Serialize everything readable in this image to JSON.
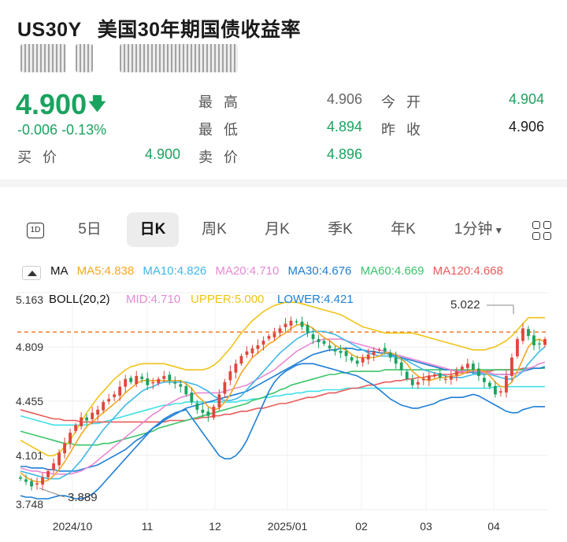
{
  "header": {
    "symbol": "US30Y",
    "name": "美国30年期国债收益率"
  },
  "quote": {
    "price": "4.900",
    "change": "-0.006",
    "change_pct": "-0.13%",
    "high_label": "最高",
    "high": "4.906",
    "open_label": "今开",
    "open": "4.904",
    "low_label": "最低",
    "low": "4.894",
    "prev_close_label": "昨收",
    "prev_close": "4.906",
    "bid_label": "买价",
    "bid": "4.900",
    "ask_label": "卖价",
    "ask": "4.896"
  },
  "tabs": [
    "5日",
    "日K",
    "周K",
    "月K",
    "季K",
    "年K",
    "1分钟"
  ],
  "active_tab": "日K",
  "indicators": {
    "ma_label": "MA",
    "ma5": "MA5:4.838",
    "ma10": "MA10:4.826",
    "ma20": "MA20:4.710",
    "ma30": "MA30:4.676",
    "ma60": "MA60:4.669",
    "ma120": "MA120:4.668",
    "boll": "BOLL(20,2)",
    "mid": "MID:4.710",
    "upper": "UPPER:5.000",
    "lower": "LOWER:4.421"
  },
  "colors": {
    "up": "#e0463c",
    "down": "#1aa35f",
    "ma5": "#f5a623",
    "ma10": "#3fb8e8",
    "ma20": "#e889d4",
    "ma30": "#1e7fd6",
    "ma60": "#3cc46a",
    "ma120": "#e85b5b",
    "upper": "#f0c419",
    "lower": "#6baef0"
  },
  "chart_data": {
    "type": "candlestick",
    "y_ticks": [
      "5.163",
      "4.809",
      "4.455",
      "4.101",
      "3.748"
    ],
    "ylim": [
      3.748,
      5.163
    ],
    "x_ticks": [
      "2024/10",
      "11",
      "12",
      "2025/01",
      "02",
      "03",
      "04"
    ],
    "annotations": {
      "max": "5.022",
      "min": "3.889"
    },
    "reference_line": 4.906,
    "closes": [
      3.95,
      3.93,
      3.9,
      3.92,
      3.96,
      4.0,
      4.05,
      4.12,
      4.18,
      4.25,
      4.3,
      4.35,
      4.33,
      4.38,
      4.4,
      4.45,
      4.47,
      4.5,
      4.55,
      4.6,
      4.58,
      4.62,
      4.6,
      4.56,
      4.58,
      4.6,
      4.62,
      4.59,
      4.57,
      4.55,
      4.5,
      4.45,
      4.4,
      4.38,
      4.36,
      4.42,
      4.5,
      4.58,
      4.65,
      4.7,
      4.75,
      4.78,
      4.8,
      4.82,
      4.85,
      4.88,
      4.9,
      4.93,
      4.96,
      4.98,
      4.97,
      4.94,
      4.9,
      4.86,
      4.84,
      4.83,
      4.8,
      4.78,
      4.77,
      4.75,
      4.72,
      4.7,
      4.74,
      4.76,
      4.78,
      4.79,
      4.78,
      4.74,
      4.7,
      4.66,
      4.6,
      4.56,
      4.58,
      4.6,
      4.62,
      4.63,
      4.61,
      4.6,
      4.62,
      4.65,
      4.68,
      4.7,
      4.66,
      4.62,
      4.58,
      4.55,
      4.5,
      4.52,
      4.62,
      4.74,
      4.86,
      4.93,
      4.88,
      4.82,
      4.83,
      4.86
    ],
    "ma5": [
      3.99,
      3.96,
      3.94,
      3.93,
      3.93,
      3.94,
      3.97,
      4.01,
      4.06,
      4.12,
      4.18,
      4.24,
      4.29,
      4.32,
      4.35,
      4.38,
      4.41,
      4.44,
      4.47,
      4.51,
      4.54,
      4.57,
      4.59,
      4.59,
      4.59,
      4.59,
      4.59,
      4.59,
      4.59,
      4.59,
      4.57,
      4.54,
      4.49,
      4.46,
      4.42,
      4.4,
      4.41,
      4.45,
      4.5,
      4.57,
      4.64,
      4.69,
      4.74,
      4.77,
      4.8,
      4.83,
      4.85,
      4.88,
      4.9,
      4.93,
      4.95,
      4.96,
      4.95,
      4.93,
      4.9,
      4.87,
      4.85,
      4.82,
      4.8,
      4.79,
      4.76,
      4.74,
      4.74,
      4.74,
      4.74,
      4.75,
      4.77,
      4.77,
      4.76,
      4.73,
      4.7,
      4.65,
      4.62,
      4.6,
      4.59,
      4.6,
      4.61,
      4.61,
      4.62,
      4.62,
      4.63,
      4.65,
      4.66,
      4.66,
      4.65,
      4.62,
      4.58,
      4.55,
      4.55,
      4.58,
      4.65,
      4.73,
      4.81,
      4.85,
      4.86,
      4.84
    ],
    "ma10": [
      4.0,
      3.99,
      3.98,
      3.97,
      3.96,
      3.95,
      3.95,
      3.95,
      3.97,
      3.99,
      4.03,
      4.07,
      4.12,
      4.17,
      4.22,
      4.27,
      4.31,
      4.35,
      4.39,
      4.43,
      4.46,
      4.49,
      4.52,
      4.54,
      4.55,
      4.57,
      4.58,
      4.58,
      4.58,
      4.58,
      4.58,
      4.57,
      4.56,
      4.54,
      4.52,
      4.49,
      4.47,
      4.46,
      4.46,
      4.47,
      4.49,
      4.53,
      4.57,
      4.61,
      4.65,
      4.69,
      4.73,
      4.77,
      4.8,
      4.83,
      4.86,
      4.88,
      4.9,
      4.91,
      4.91,
      4.91,
      4.9,
      4.89,
      4.87,
      4.85,
      4.83,
      4.81,
      4.79,
      4.77,
      4.76,
      4.75,
      4.75,
      4.75,
      4.74,
      4.73,
      4.72,
      4.7,
      4.68,
      4.66,
      4.65,
      4.64,
      4.63,
      4.62,
      4.61,
      4.61,
      4.61,
      4.62,
      4.63,
      4.63,
      4.63,
      4.63,
      4.62,
      4.61,
      4.6,
      4.6,
      4.62,
      4.65,
      4.7,
      4.74,
      4.78,
      4.81
    ],
    "ma20": [
      4.02,
      4.01,
      4.0,
      4.0,
      3.99,
      3.99,
      3.98,
      3.98,
      3.98,
      3.98,
      3.99,
      4.0,
      4.02,
      4.04,
      4.07,
      4.1,
      4.13,
      4.16,
      4.19,
      4.22,
      4.25,
      4.28,
      4.31,
      4.34,
      4.37,
      4.39,
      4.42,
      4.44,
      4.46,
      4.48,
      4.49,
      4.5,
      4.51,
      4.51,
      4.51,
      4.51,
      4.51,
      4.52,
      4.53,
      4.54,
      4.55,
      4.56,
      4.58,
      4.6,
      4.62,
      4.64,
      4.66,
      4.69,
      4.72,
      4.75,
      4.78,
      4.8,
      4.82,
      4.84,
      4.85,
      4.86,
      4.86,
      4.86,
      4.86,
      4.85,
      4.84,
      4.83,
      4.82,
      4.81,
      4.8,
      4.79,
      4.78,
      4.77,
      4.76,
      4.75,
      4.74,
      4.73,
      4.72,
      4.71,
      4.7,
      4.69,
      4.68,
      4.67,
      4.66,
      4.65,
      4.65,
      4.65,
      4.65,
      4.65,
      4.64,
      4.64,
      4.63,
      4.63,
      4.63,
      4.63,
      4.64,
      4.65,
      4.67,
      4.68,
      4.7,
      4.71
    ],
    "ma30": [
      4.03,
      4.03,
      4.02,
      4.02,
      4.02,
      4.01,
      4.01,
      4.0,
      4.0,
      4.0,
      4.0,
      4.01,
      4.02,
      4.03,
      4.04,
      4.06,
      4.08,
      4.1,
      4.12,
      4.14,
      4.17,
      4.2,
      4.22,
      4.25,
      4.28,
      4.3,
      4.33,
      4.35,
      4.37,
      4.39,
      4.41,
      4.42,
      4.43,
      4.44,
      4.45,
      4.46,
      4.47,
      4.48,
      4.49,
      4.5,
      4.51,
      4.52,
      4.54,
      4.56,
      4.58,
      4.6,
      4.62,
      4.64,
      4.66,
      4.68,
      4.7,
      4.72,
      4.74,
      4.76,
      4.77,
      4.78,
      4.79,
      4.79,
      4.8,
      4.8,
      4.8,
      4.79,
      4.79,
      4.78,
      4.78,
      4.77,
      4.77,
      4.76,
      4.75,
      4.74,
      4.73,
      4.72,
      4.71,
      4.7,
      4.69,
      4.68,
      4.67,
      4.66,
      4.66,
      4.65,
      4.65,
      4.65,
      4.64,
      4.64,
      4.64,
      4.64,
      4.63,
      4.63,
      4.63,
      4.63,
      4.64,
      4.65,
      4.66,
      4.67,
      4.67,
      4.68
    ],
    "ma60": [
      4.26,
      4.25,
      4.24,
      4.23,
      4.22,
      4.21,
      4.2,
      4.19,
      4.18,
      4.18,
      4.17,
      4.17,
      4.17,
      4.17,
      4.17,
      4.18,
      4.18,
      4.19,
      4.2,
      4.21,
      4.22,
      4.23,
      4.24,
      4.25,
      4.26,
      4.28,
      4.29,
      4.3,
      4.31,
      4.32,
      4.33,
      4.34,
      4.35,
      4.36,
      4.37,
      4.38,
      4.39,
      4.4,
      4.41,
      4.42,
      4.43,
      4.44,
      4.46,
      4.47,
      4.48,
      4.5,
      4.51,
      4.53,
      4.54,
      4.56,
      4.57,
      4.58,
      4.59,
      4.6,
      4.61,
      4.62,
      4.63,
      4.63,
      4.64,
      4.64,
      4.65,
      4.65,
      4.65,
      4.65,
      4.65,
      4.65,
      4.66,
      4.66,
      4.66,
      4.66,
      4.66,
      4.66,
      4.66,
      4.66,
      4.66,
      4.66,
      4.66,
      4.66,
      4.66,
      4.66,
      4.66,
      4.66,
      4.66,
      4.66,
      4.66,
      4.66,
      4.66,
      4.66,
      4.66,
      4.66,
      4.66,
      4.66,
      4.67,
      4.67,
      4.67,
      4.67
    ],
    "ma120": [
      4.4,
      4.39,
      4.38,
      4.37,
      4.36,
      4.35,
      4.34,
      4.34,
      4.33,
      4.33,
      4.33,
      4.32,
      4.32,
      4.32,
      4.32,
      4.32,
      4.32,
      4.32,
      4.32,
      4.32,
      4.32,
      4.32,
      4.32,
      4.32,
      4.32,
      4.32,
      4.32,
      4.33,
      4.33,
      4.33,
      4.33,
      4.34,
      4.34,
      4.35,
      4.35,
      4.36,
      4.36,
      4.37,
      4.37,
      4.38,
      4.39,
      4.39,
      4.4,
      4.41,
      4.41,
      4.42,
      4.43,
      4.44,
      4.44,
      4.45,
      4.46,
      4.47,
      4.48,
      4.48,
      4.49,
      4.5,
      4.51,
      4.51,
      4.52,
      4.53,
      4.54,
      4.54,
      4.55,
      4.56,
      4.56,
      4.57,
      4.58,
      4.58,
      4.59,
      4.59,
      4.6,
      4.6,
      4.61,
      4.61,
      4.62,
      4.62,
      4.63,
      4.63,
      4.63,
      4.64,
      4.64,
      4.64,
      4.65,
      4.65,
      4.65,
      4.65,
      4.66,
      4.66,
      4.66,
      4.66,
      4.66,
      4.67,
      4.67,
      4.67,
      4.67,
      4.67
    ],
    "upper": [
      4.2,
      4.18,
      4.16,
      4.14,
      4.12,
      4.1,
      4.1,
      4.12,
      4.16,
      4.2,
      4.26,
      4.32,
      4.38,
      4.43,
      4.48,
      4.52,
      4.56,
      4.6,
      4.63,
      4.66,
      4.68,
      4.69,
      4.7,
      4.7,
      4.7,
      4.7,
      4.7,
      4.69,
      4.68,
      4.67,
      4.66,
      4.66,
      4.66,
      4.66,
      4.67,
      4.69,
      4.72,
      4.76,
      4.8,
      4.85,
      4.9,
      4.94,
      4.98,
      5.01,
      5.04,
      5.06,
      5.08,
      5.09,
      5.1,
      5.1,
      5.1,
      5.09,
      5.08,
      5.07,
      5.06,
      5.05,
      5.04,
      5.03,
      5.02,
      5.0,
      4.98,
      4.96,
      4.94,
      4.93,
      4.92,
      4.91,
      4.9,
      4.9,
      4.9,
      4.9,
      4.9,
      4.9,
      4.89,
      4.88,
      4.87,
      4.86,
      4.85,
      4.84,
      4.83,
      4.82,
      4.81,
      4.8,
      4.79,
      4.79,
      4.79,
      4.8,
      4.81,
      4.83,
      4.85,
      4.88,
      4.92,
      4.96,
      5.0,
      5.0,
      5.0,
      5.0
    ],
    "lower": [
      3.84,
      3.83,
      3.83,
      3.82,
      3.82,
      3.82,
      3.83,
      3.84,
      3.84,
      3.83,
      3.82,
      3.82,
      3.83,
      3.85,
      3.88,
      3.92,
      3.96,
      4.0,
      4.04,
      4.08,
      4.12,
      4.16,
      4.2,
      4.24,
      4.28,
      4.31,
      4.34,
      4.36,
      4.38,
      4.39,
      4.4,
      4.35,
      4.3,
      4.25,
      4.2,
      4.15,
      4.1,
      4.08,
      4.08,
      4.1,
      4.14,
      4.2,
      4.28,
      4.36,
      4.44,
      4.52,
      4.58,
      4.62,
      4.65,
      4.67,
      4.69,
      4.7,
      4.7,
      4.7,
      4.69,
      4.68,
      4.67,
      4.66,
      4.65,
      4.64,
      4.63,
      4.62,
      4.6,
      4.58,
      4.56,
      4.53,
      4.5,
      4.47,
      4.45,
      4.43,
      4.42,
      4.41,
      4.41,
      4.42,
      4.43,
      4.44,
      4.46,
      4.47,
      4.48,
      4.48,
      4.48,
      4.49,
      4.5,
      4.49,
      4.47,
      4.45,
      4.43,
      4.41,
      4.39,
      4.38,
      4.38,
      4.4,
      4.41,
      4.42,
      4.42,
      4.42
    ],
    "long_ma": [
      4.36,
      4.35,
      4.34,
      4.33,
      4.32,
      4.31,
      4.3,
      4.3,
      4.3,
      4.3,
      4.3,
      4.3,
      4.3,
      4.31,
      4.31,
      4.32,
      4.33,
      4.34,
      4.35,
      4.36,
      4.37,
      4.38,
      4.39,
      4.4,
      4.41,
      4.42,
      4.43,
      4.43,
      4.44,
      4.44,
      4.45,
      4.45,
      4.45,
      4.45,
      4.45,
      4.45,
      4.45,
      4.45,
      4.45,
      4.45,
      4.46,
      4.46,
      4.47,
      4.47,
      4.48,
      4.48,
      4.49,
      4.49,
      4.5,
      4.5,
      4.51,
      4.51,
      4.52,
      4.52,
      4.52,
      4.53,
      4.53,
      4.53,
      4.53,
      4.54,
      4.54,
      4.54,
      4.54,
      4.54,
      4.54,
      4.54,
      4.54,
      4.54,
      4.54,
      4.54,
      4.54,
      4.54,
      4.54,
      4.54,
      4.54,
      4.54,
      4.54,
      4.54,
      4.54,
      4.54,
      4.54,
      4.54,
      4.54,
      4.54,
      4.54,
      4.54,
      4.55,
      4.55,
      4.55,
      4.55,
      4.55,
      4.55,
      4.55,
      4.55,
      4.55,
      4.55
    ]
  }
}
